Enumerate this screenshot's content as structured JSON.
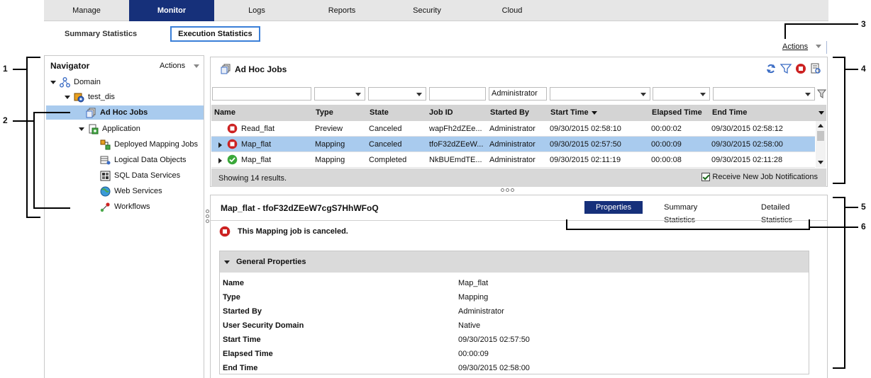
{
  "top_tabs": [
    {
      "label": "Manage",
      "active": false
    },
    {
      "label": "Monitor",
      "active": true
    },
    {
      "label": "Logs",
      "active": false
    },
    {
      "label": "Reports",
      "active": false
    },
    {
      "label": "Security",
      "active": false
    },
    {
      "label": "Cloud",
      "active": false
    }
  ],
  "sub_tabs": [
    {
      "label": "Summary Statistics",
      "active": false
    },
    {
      "label": "Execution Statistics",
      "active": true
    }
  ],
  "global_actions_label": "Actions",
  "navigator": {
    "title": "Navigator",
    "actions_label": "Actions",
    "tree": [
      {
        "label": "Domain",
        "icon": "domain-icon"
      },
      {
        "label": "test_dis",
        "icon": "data-integration-service-icon"
      },
      {
        "label": "Ad Hoc Jobs",
        "icon": "ad-hoc-jobs-icon",
        "selected": true
      },
      {
        "label": "Application",
        "icon": "application-icon"
      },
      {
        "label": "Deployed Mapping Jobs",
        "icon": "deployed-mapping-jobs-icon"
      },
      {
        "label": "Logical Data Objects",
        "icon": "logical-data-objects-icon"
      },
      {
        "label": "SQL Data Services",
        "icon": "sql-data-services-icon"
      },
      {
        "label": "Web Services",
        "icon": "web-services-icon"
      },
      {
        "label": "Workflows",
        "icon": "workflows-icon"
      }
    ]
  },
  "jobs": {
    "title": "Ad Hoc Jobs",
    "filter_started_by_value": "Administrator",
    "columns": [
      "Name",
      "Type",
      "State",
      "Job ID",
      "Started By",
      "Start Time",
      "Elapsed Time",
      "End Time"
    ],
    "rows": [
      {
        "name": "Read_flat",
        "type": "Preview",
        "state": "Canceled",
        "job_id": "wapFh2dZEe...",
        "started_by": "Administrator",
        "start_time": "09/30/2015 02:58:10",
        "elapsed": "00:00:02",
        "end_time": "09/30/2015 02:58:12",
        "status": "canceled",
        "expandable": false,
        "selected": false
      },
      {
        "name": "Map_flat",
        "type": "Mapping",
        "state": "Canceled",
        "job_id": "tfoF32dZEeW...",
        "started_by": "Administrator",
        "start_time": "09/30/2015 02:57:50",
        "elapsed": "00:00:09",
        "end_time": "09/30/2015 02:58:00",
        "status": "canceled",
        "expandable": true,
        "selected": true
      },
      {
        "name": "Map_flat",
        "type": "Mapping",
        "state": "Completed",
        "job_id": "NkBUEmdTE...",
        "started_by": "Administrator",
        "start_time": "09/30/2015 02:11:19",
        "elapsed": "00:00:08",
        "end_time": "09/30/2015 02:11:28",
        "status": "completed",
        "expandable": true,
        "selected": false
      }
    ],
    "footer_count": "Showing 14 results.",
    "notifications_label": "Receive New Job Notifications"
  },
  "detail": {
    "title": "Map_flat - tfoF32dZEeW7cgS7HhWFoQ",
    "tabs": [
      {
        "label": "Properties",
        "active": true
      },
      {
        "label": "Summary Statistics",
        "active": false
      },
      {
        "label": "Detailed Statistics",
        "active": false
      }
    ],
    "message": "This Mapping job is canceled.",
    "section_title": "General Properties",
    "properties": [
      {
        "name": "Name",
        "value": "Map_flat"
      },
      {
        "name": "Type",
        "value": "Mapping"
      },
      {
        "name": "Started By",
        "value": "Administrator"
      },
      {
        "name": "User Security Domain",
        "value": "Native"
      },
      {
        "name": "Start Time",
        "value": "09/30/2015 02:57:50"
      },
      {
        "name": "Elapsed Time",
        "value": "00:00:09"
      },
      {
        "name": "End Time",
        "value": "09/30/2015 02:58:00"
      }
    ]
  },
  "callouts": [
    "1",
    "2",
    "3",
    "4",
    "5",
    "6"
  ],
  "colors": {
    "active_tab": "#16307a",
    "selection": "#a9cbee",
    "canceled": "#cc2222",
    "completed": "#3aa83a"
  }
}
